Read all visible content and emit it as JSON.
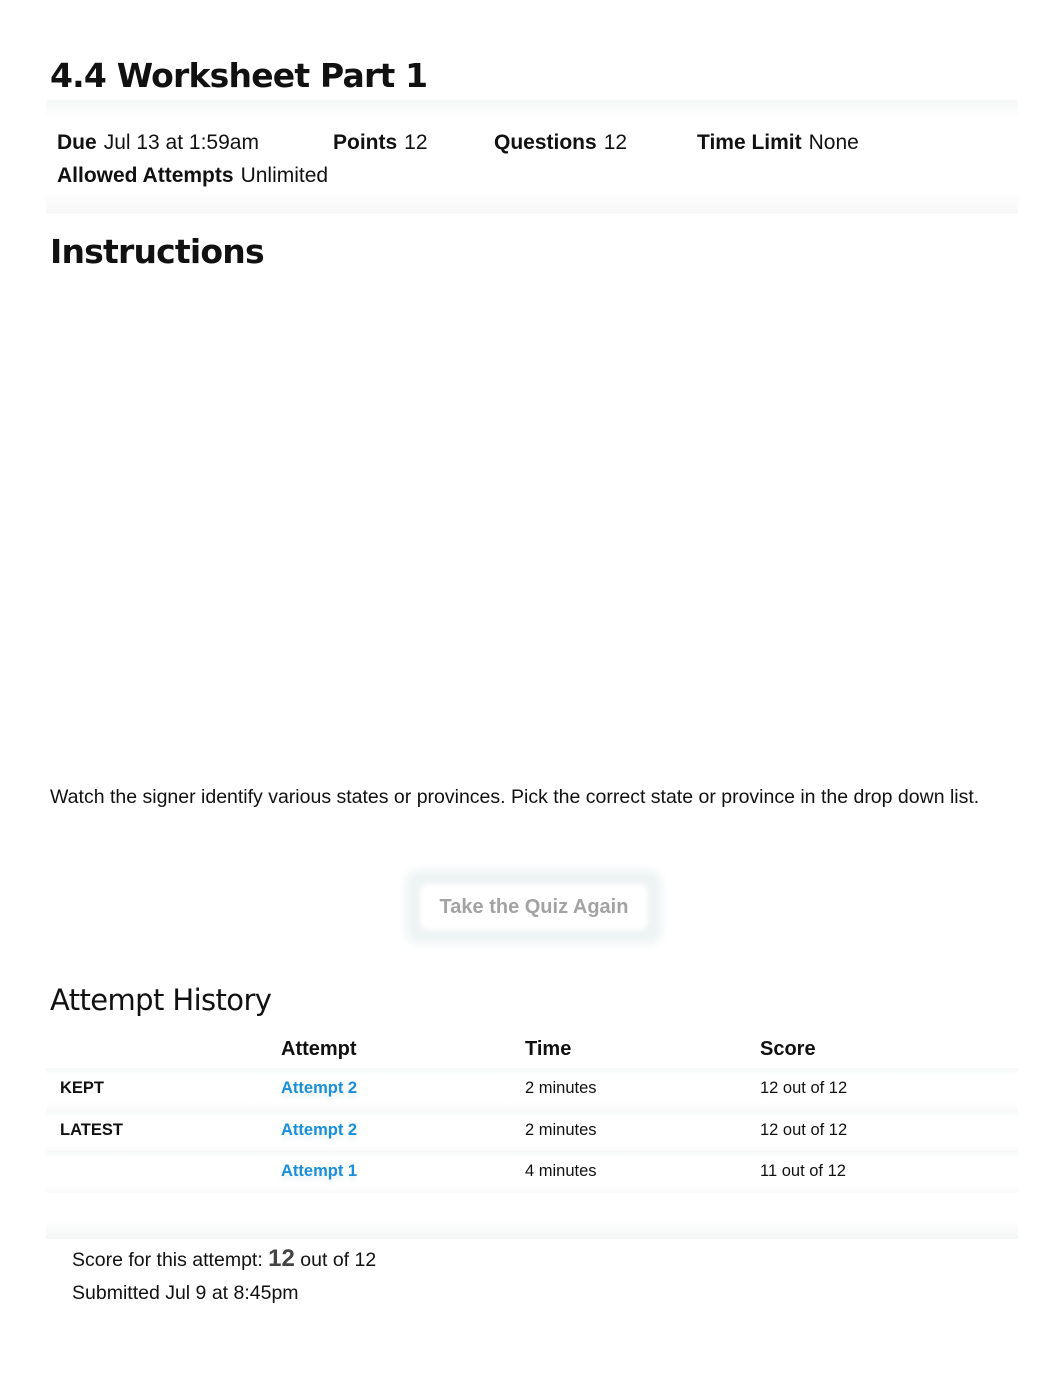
{
  "quiz": {
    "title": "4.4 Worksheet Part 1",
    "details": {
      "due_label": "Due",
      "due_value": "Jul 13 at 1:59am",
      "points_label": "Points",
      "points_value": "12",
      "questions_label": "Questions",
      "questions_value": "12",
      "time_limit_label": "Time Limit",
      "time_limit_value": "None",
      "allowed_attempts_label": "Allowed Attempts",
      "allowed_attempts_value": "Unlimited"
    }
  },
  "instructions": {
    "heading": "Instructions",
    "text": "Watch the signer identify various states or provinces. Pick the correct state or province in the drop down list."
  },
  "actions": {
    "take_again_label": "Take the Quiz Again"
  },
  "attempt_history": {
    "heading": "Attempt History",
    "columns": [
      "",
      "Attempt",
      "Time",
      "Score"
    ],
    "rows": [
      {
        "status": "KEPT",
        "attempt": "Attempt 2",
        "time": "2 minutes",
        "score": "12 out of 12"
      },
      {
        "status": "LATEST",
        "attempt": "Attempt 2",
        "time": "2 minutes",
        "score": "12 out of 12"
      },
      {
        "status": "",
        "attempt": "Attempt 1",
        "time": "4 minutes",
        "score": "11 out of 12"
      }
    ]
  },
  "summary": {
    "score_prefix": "Score for this attempt:",
    "score_value": "12",
    "score_suffix": "out of 12",
    "submitted": "Submitted Jul 9 at 8:45pm"
  },
  "colors": {
    "link": "#1a8fd8",
    "button_text_disabled": "#a3a3a3"
  }
}
